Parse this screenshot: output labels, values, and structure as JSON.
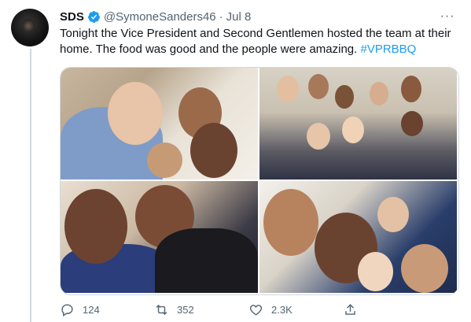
{
  "tweet": {
    "author_name": "SDS",
    "handle": "@SymoneSanders46",
    "separator": "·",
    "date": "Jul 8",
    "more_label": "···",
    "text": "Tonight the Vice President and Second Gentlemen hosted the team at their home. The food was good and the people were amazing. ",
    "hashtag": "#VPRBBQ"
  },
  "actions": {
    "reply_count": "124",
    "retweet_count": "352",
    "like_count": "2.3K"
  },
  "colors": {
    "accent": "#1d9bf0",
    "muted": "#536471",
    "text": "#0f1419"
  },
  "icons": [
    "verified-badge-icon",
    "more-icon",
    "reply-icon",
    "retweet-icon",
    "like-icon",
    "share-icon"
  ]
}
